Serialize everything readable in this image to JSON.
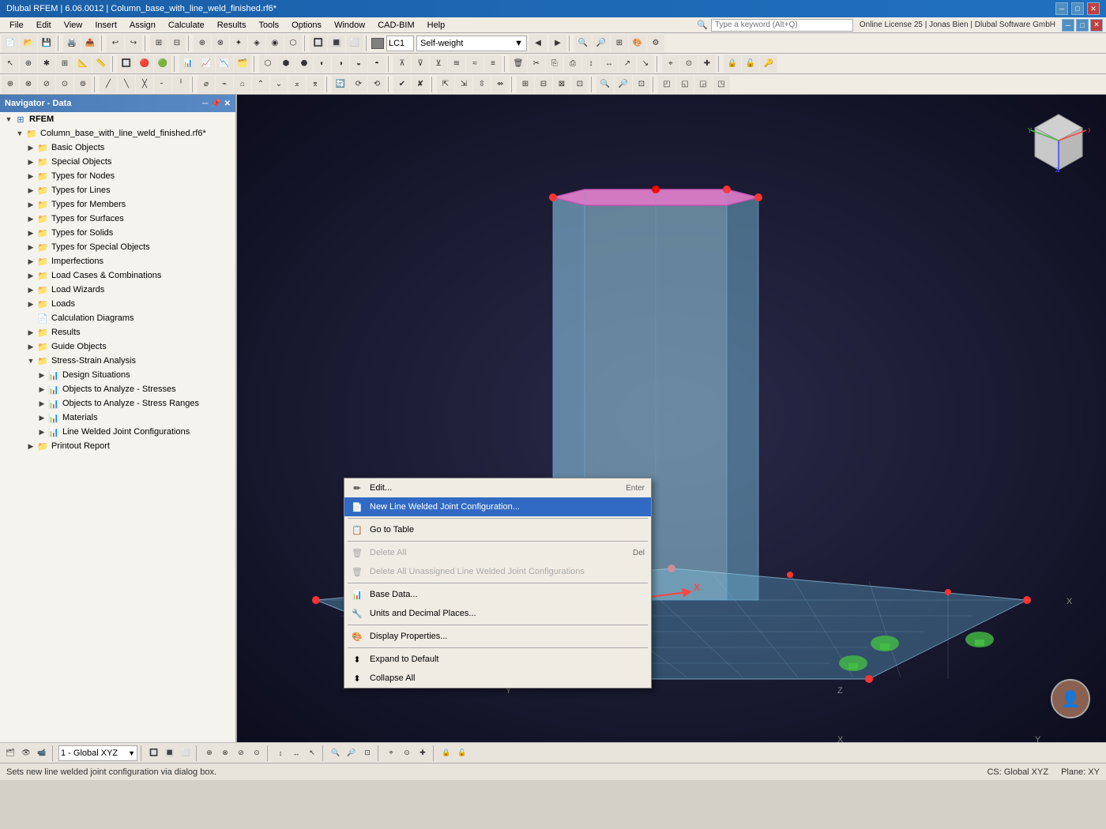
{
  "titlebar": {
    "title": "Dlubal RFEM | 6.06.0012 | Column_base_with_line_weld_finished.rf6*",
    "min_label": "─",
    "max_label": "□",
    "close_label": "✕"
  },
  "menubar": {
    "items": [
      "File",
      "Edit",
      "View",
      "Insert",
      "Assign",
      "Calculate",
      "Results",
      "Tools",
      "Options",
      "Window",
      "CAD-BIM",
      "Help"
    ]
  },
  "licensebar": {
    "search_placeholder": "Type a keyword (Alt+Q)",
    "license_text": "Online License 25 | Jonas Bien | Dlubal Software GmbH"
  },
  "navigator": {
    "title": "Navigator - Data",
    "root": "RFEM",
    "file": "Column_base_with_line_weld_finished.rf6*",
    "items": [
      {
        "id": "rfem",
        "label": "RFEM",
        "level": 0,
        "type": "root",
        "expanded": true
      },
      {
        "id": "file",
        "label": "Column_base_with_line_weld_finished.rf6*",
        "level": 1,
        "type": "file",
        "expanded": true
      },
      {
        "id": "basic",
        "label": "Basic Objects",
        "level": 2,
        "type": "folder",
        "expanded": false
      },
      {
        "id": "special",
        "label": "Special Objects",
        "level": 2,
        "type": "folder",
        "expanded": false
      },
      {
        "id": "nodes",
        "label": "Types for Nodes",
        "level": 2,
        "type": "folder",
        "expanded": false
      },
      {
        "id": "lines",
        "label": "Types for Lines",
        "level": 2,
        "type": "folder",
        "expanded": false
      },
      {
        "id": "members",
        "label": "Types for Members",
        "level": 2,
        "type": "folder",
        "expanded": false
      },
      {
        "id": "surfaces",
        "label": "Types for Surfaces",
        "level": 2,
        "type": "folder",
        "expanded": false
      },
      {
        "id": "solids",
        "label": "Types for Solids",
        "level": 2,
        "type": "folder",
        "expanded": false
      },
      {
        "id": "special-objects",
        "label": "Types for Special Objects",
        "level": 2,
        "type": "folder",
        "expanded": false
      },
      {
        "id": "imperfections",
        "label": "Imperfections",
        "level": 2,
        "type": "folder",
        "expanded": false
      },
      {
        "id": "load-cases",
        "label": "Load Cases & Combinations",
        "level": 2,
        "type": "folder",
        "expanded": false
      },
      {
        "id": "load-wizards",
        "label": "Load Wizards",
        "level": 2,
        "type": "folder",
        "expanded": false
      },
      {
        "id": "loads",
        "label": "Loads",
        "level": 2,
        "type": "folder",
        "expanded": false
      },
      {
        "id": "calc-diag",
        "label": "Calculation Diagrams",
        "level": 2,
        "type": "item",
        "expanded": false
      },
      {
        "id": "results",
        "label": "Results",
        "level": 2,
        "type": "folder",
        "expanded": false
      },
      {
        "id": "guide-objects",
        "label": "Guide Objects",
        "level": 2,
        "type": "folder",
        "expanded": false
      },
      {
        "id": "stress-strain",
        "label": "Stress-Strain Analysis",
        "level": 2,
        "type": "folder",
        "expanded": true
      },
      {
        "id": "design-sit",
        "label": "Design Situations",
        "level": 3,
        "type": "subfolder",
        "expanded": false
      },
      {
        "id": "obj-stresses",
        "label": "Objects to Analyze - Stresses",
        "level": 3,
        "type": "subfolder",
        "expanded": false
      },
      {
        "id": "obj-stress-ranges",
        "label": "Objects to Analyze - Stress Ranges",
        "level": 3,
        "type": "subfolder",
        "expanded": false
      },
      {
        "id": "materials",
        "label": "Materials",
        "level": 3,
        "type": "subfolder",
        "expanded": false
      },
      {
        "id": "line-welded",
        "label": "Line Welded Joint Configurations",
        "level": 3,
        "type": "subfolder",
        "expanded": false,
        "selected": true
      },
      {
        "id": "printout",
        "label": "Printout Report",
        "level": 2,
        "type": "folder",
        "expanded": false
      }
    ]
  },
  "context_menu": {
    "items": [
      {
        "id": "edit",
        "label": "Edit...",
        "shortcut": "Enter",
        "icon": "✏️",
        "disabled": false,
        "highlighted": false
      },
      {
        "id": "new",
        "label": "New Line Welded Joint Configuration...",
        "shortcut": "",
        "icon": "📄",
        "disabled": false,
        "highlighted": true
      },
      {
        "id": "sep1",
        "type": "separator"
      },
      {
        "id": "goto-table",
        "label": "Go to Table",
        "shortcut": "",
        "icon": "📋",
        "disabled": false,
        "highlighted": false
      },
      {
        "id": "sep2",
        "type": "separator"
      },
      {
        "id": "delete-all",
        "label": "Delete All",
        "shortcut": "Del",
        "icon": "🗑️",
        "disabled": true,
        "highlighted": false
      },
      {
        "id": "delete-unassigned",
        "label": "Delete All Unassigned Line Welded Joint Configurations",
        "shortcut": "",
        "icon": "🗑️",
        "disabled": true,
        "highlighted": false
      },
      {
        "id": "sep3",
        "type": "separator"
      },
      {
        "id": "base-data",
        "label": "Base Data...",
        "shortcut": "",
        "icon": "📊",
        "disabled": false,
        "highlighted": false
      },
      {
        "id": "units",
        "label": "Units and Decimal Places...",
        "shortcut": "",
        "icon": "🔧",
        "disabled": false,
        "highlighted": false
      },
      {
        "id": "sep4",
        "type": "separator"
      },
      {
        "id": "display-props",
        "label": "Display Properties...",
        "shortcut": "",
        "icon": "🎨",
        "disabled": false,
        "highlighted": false
      },
      {
        "id": "sep5",
        "type": "separator"
      },
      {
        "id": "expand",
        "label": "Expand to Default",
        "shortcut": "",
        "icon": "↕",
        "disabled": false,
        "highlighted": false
      },
      {
        "id": "collapse",
        "label": "Collapse All",
        "shortcut": "",
        "icon": "↕",
        "disabled": false,
        "highlighted": false
      }
    ]
  },
  "statusbar": {
    "message": "Sets new line welded joint configuration via dialog box.",
    "cs_label": "CS: Global XYZ",
    "plane_label": "Plane: XY"
  },
  "bottom_toolbar": {
    "coord_system": "1 - Global XYZ"
  },
  "toolbar1": {
    "lc_label": "LC1",
    "load_type": "Self-weight"
  }
}
